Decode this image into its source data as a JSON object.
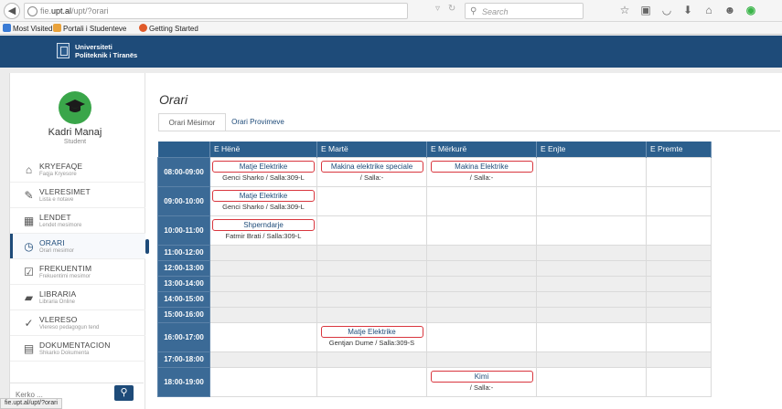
{
  "browser": {
    "url_prefix": "fie.",
    "url_domain": "upt.al",
    "url_path": "/upt/?orari",
    "search_placeholder": "Search",
    "status_url": "fie.upt.al/upt/?orari"
  },
  "bookmarks": [
    {
      "label": "Most Visited",
      "color": "#3a7bd5"
    },
    {
      "label": "Portali i Studenteve",
      "color": "#e9a23b"
    },
    {
      "label": "Getting Started",
      "color": "#e05a2a"
    }
  ],
  "header": {
    "logo_line1": "Universiteti",
    "logo_line2": "Politeknik i Tiranës"
  },
  "user": {
    "name": "Kadri Manaj",
    "role": "Student"
  },
  "nav": [
    {
      "title": "KRYEFAQE",
      "subtitle": "Faqja Kryesore",
      "icon": "home-icon",
      "glyph": "⌂"
    },
    {
      "title": "VLERESIMET",
      "subtitle": "Lista e notave",
      "icon": "edit-icon",
      "glyph": "✎"
    },
    {
      "title": "LENDET",
      "subtitle": "Lendet mesimore",
      "icon": "calendar-icon",
      "glyph": "▦"
    },
    {
      "title": "ORARI",
      "subtitle": "Orari mesimor",
      "icon": "clock-icon",
      "glyph": "◷"
    },
    {
      "title": "FREKUENTIM",
      "subtitle": "Frekuentimi mesimor",
      "icon": "checkbox-icon",
      "glyph": "☑"
    },
    {
      "title": "LIBRARIA",
      "subtitle": "Libraria Online",
      "icon": "book-icon",
      "glyph": "▰"
    },
    {
      "title": "VLERESO",
      "subtitle": "Vlereso pedagogun tend",
      "icon": "check-circle-icon",
      "glyph": "✓"
    },
    {
      "title": "DOKUMENTACION",
      "subtitle": "Shkarko Dokumenta",
      "icon": "document-icon",
      "glyph": "▤"
    }
  ],
  "sidebar_search": {
    "placeholder": "Kerko ..."
  },
  "main": {
    "title": "Orari",
    "tabs": [
      "Orari Mësimor",
      "Orari Provimeve"
    ]
  },
  "schedule": {
    "days": [
      "E Hënë",
      "E Martë",
      "E Mërkurë",
      "E Enjte",
      "E Premte"
    ],
    "rows": [
      {
        "time": "08:00-09:00",
        "cells": [
          {
            "subject": "Matje Elektrike",
            "info": "Genci Sharko / Salla:309-L"
          },
          {
            "subject": "Makina elektrike speciale",
            "info": "/ Salla:-"
          },
          {
            "subject": "Makina Elektrike",
            "info": "/ Salla:-"
          },
          null,
          null
        ]
      },
      {
        "time": "09:00-10:00",
        "cells": [
          {
            "subject": "Matje Elektrike",
            "info": "Genci Sharko / Salla:309-L"
          },
          null,
          null,
          null,
          null
        ]
      },
      {
        "time": "10:00-11:00",
        "cells": [
          {
            "subject": "Shperndarje",
            "info": "Fatmir Brati / Salla:309-L"
          },
          null,
          null,
          null,
          null
        ]
      },
      {
        "time": "11:00-12:00",
        "cells": [
          null,
          null,
          null,
          null,
          null
        ]
      },
      {
        "time": "12:00-13:00",
        "cells": [
          null,
          null,
          null,
          null,
          null
        ]
      },
      {
        "time": "13:00-14:00",
        "cells": [
          null,
          null,
          null,
          null,
          null
        ]
      },
      {
        "time": "14:00-15:00",
        "cells": [
          null,
          null,
          null,
          null,
          null
        ]
      },
      {
        "time": "15:00-16:00",
        "cells": [
          null,
          null,
          null,
          null,
          null
        ]
      },
      {
        "time": "16:00-17:00",
        "cells": [
          null,
          {
            "subject": "Matje Elektrike",
            "info": "Gentjan Dume / Salla:309-S"
          },
          null,
          null,
          null
        ]
      },
      {
        "time": "17:00-18:00",
        "cells": [
          null,
          null,
          null,
          null,
          null
        ]
      },
      {
        "time": "18:00-19:00",
        "cells": [
          null,
          null,
          {
            "subject": "Kimi",
            "info": "/ Salla:-"
          },
          null,
          null
        ]
      }
    ]
  },
  "colors": {
    "header_blue": "#1e4b79",
    "table_header": "#2c5f8d",
    "time_cell": "#3b6a96",
    "subject_border": "#d9363e",
    "avatar_green": "#3aa64a"
  }
}
